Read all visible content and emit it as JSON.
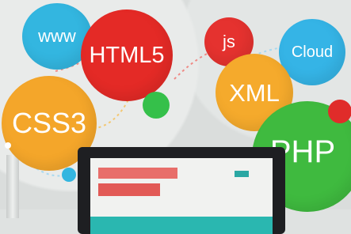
{
  "bubbles": {
    "www": "www",
    "html5": "HTML5",
    "css3": "CSS3",
    "js": "js",
    "cloud": "Cloud",
    "xml": "XML",
    "php": "PHP"
  },
  "colors": {
    "www": "#33b6e0",
    "html5": "#e42a26",
    "css3": "#f4a62a",
    "js": "#e5322f",
    "cloud": "#35b4e6",
    "xml": "#f5aa2c",
    "php": "#3fba3f",
    "green_dot": "#35c04a",
    "red_dot": "#e02c2a",
    "blue_dot": "#33b6e0",
    "monitor_bezel": "#1e1f22",
    "screen_teal": "#2ab7b0"
  }
}
